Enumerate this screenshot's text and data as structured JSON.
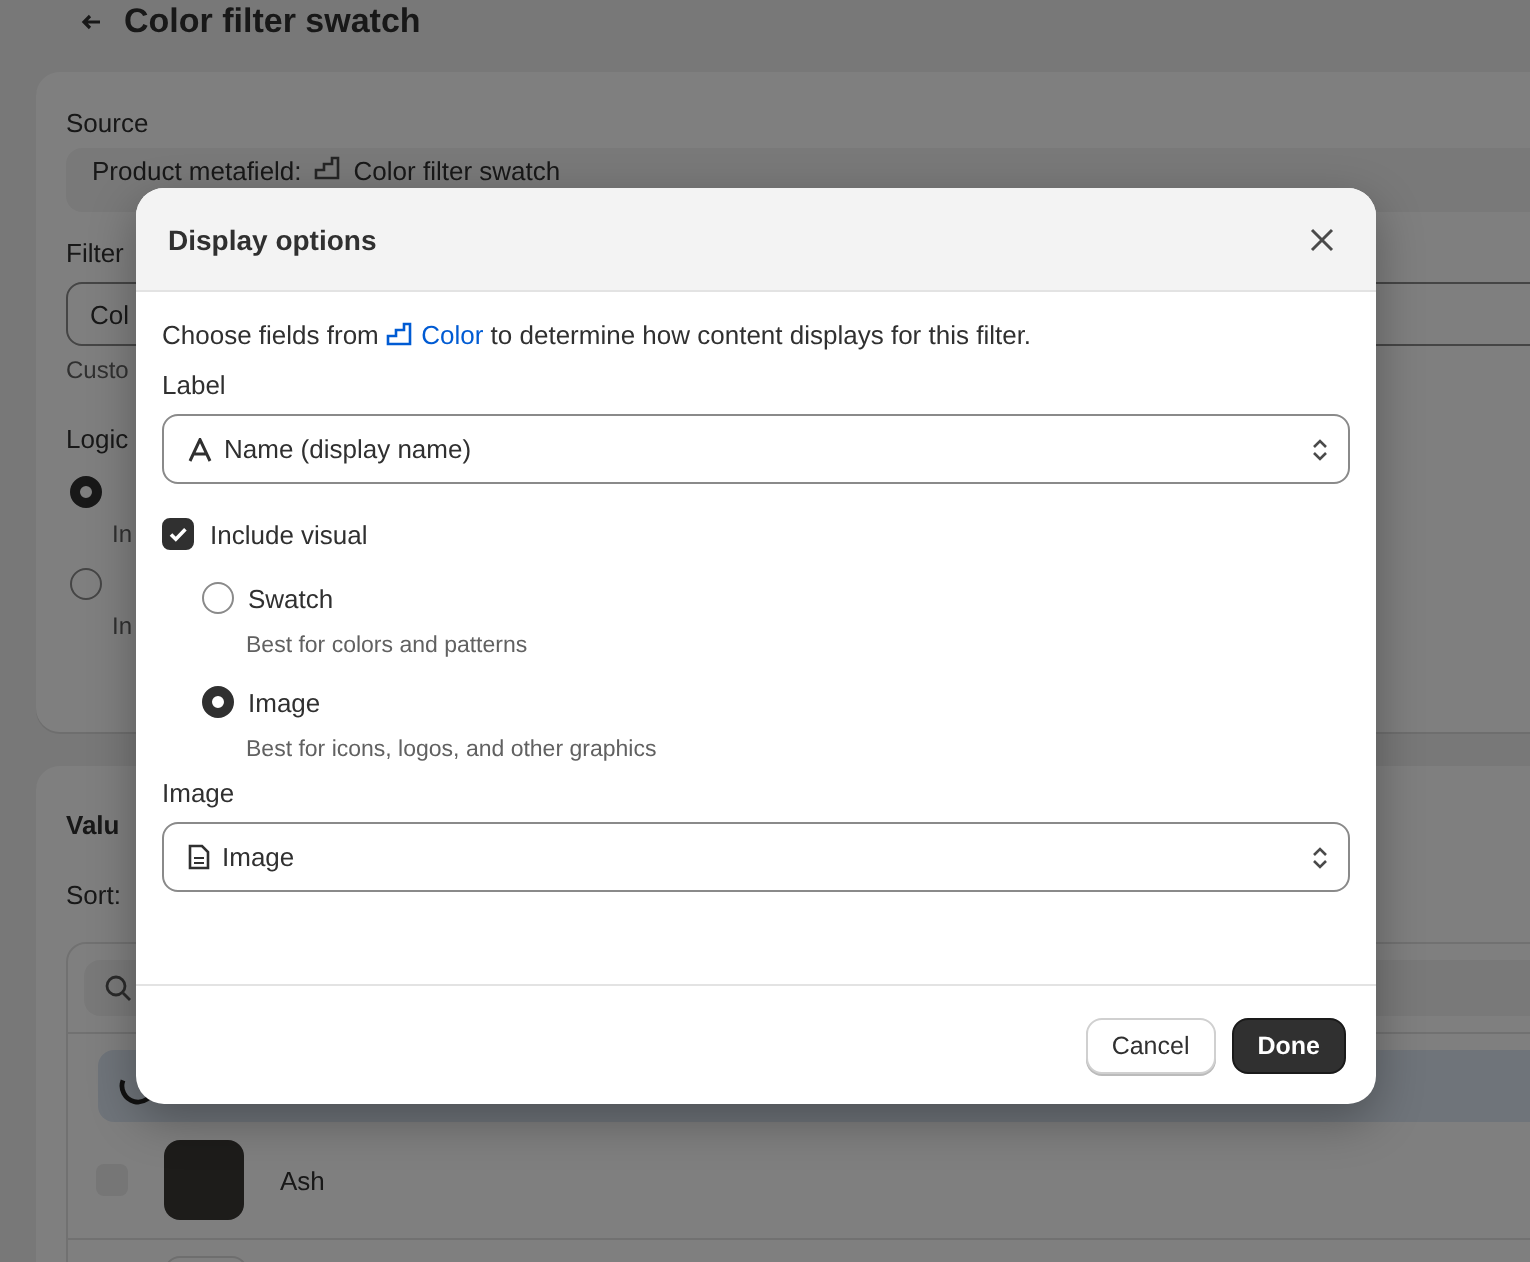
{
  "page": {
    "title": "Color filter swatch"
  },
  "source_card": {
    "source_label": "Source",
    "source_value_prefix": "Product metafield:",
    "source_value": "Color filter swatch",
    "filter_label": "Filter",
    "filter_value": "Col",
    "filter_help": "Custo",
    "logic_label": "Logic",
    "logic_options": [
      {
        "help": "In",
        "selected": true
      },
      {
        "help": "In",
        "selected": false
      }
    ]
  },
  "values_card": {
    "title": "Valu",
    "sort_label": "Sort:",
    "rows": [
      {
        "kind": "loading"
      },
      {
        "kind": "item",
        "name": "Ash",
        "checked": false
      },
      {
        "kind": "partial"
      }
    ]
  },
  "dialog": {
    "title": "Display options",
    "intro_before": "Choose fields from",
    "intro_link": "Color",
    "intro_after": "to determine how content displays for this filter.",
    "label_field": {
      "label": "Label",
      "value": "Name (display name)"
    },
    "include_visual": {
      "label": "Include visual",
      "checked": true
    },
    "visual_options": [
      {
        "label": "Swatch",
        "help": "Best for colors and patterns",
        "selected": false
      },
      {
        "label": "Image",
        "help": "Best for icons, logos, and other graphics",
        "selected": true
      }
    ],
    "image_field": {
      "label": "Image",
      "value": "Image"
    },
    "buttons": {
      "cancel": "Cancel",
      "done": "Done"
    }
  }
}
